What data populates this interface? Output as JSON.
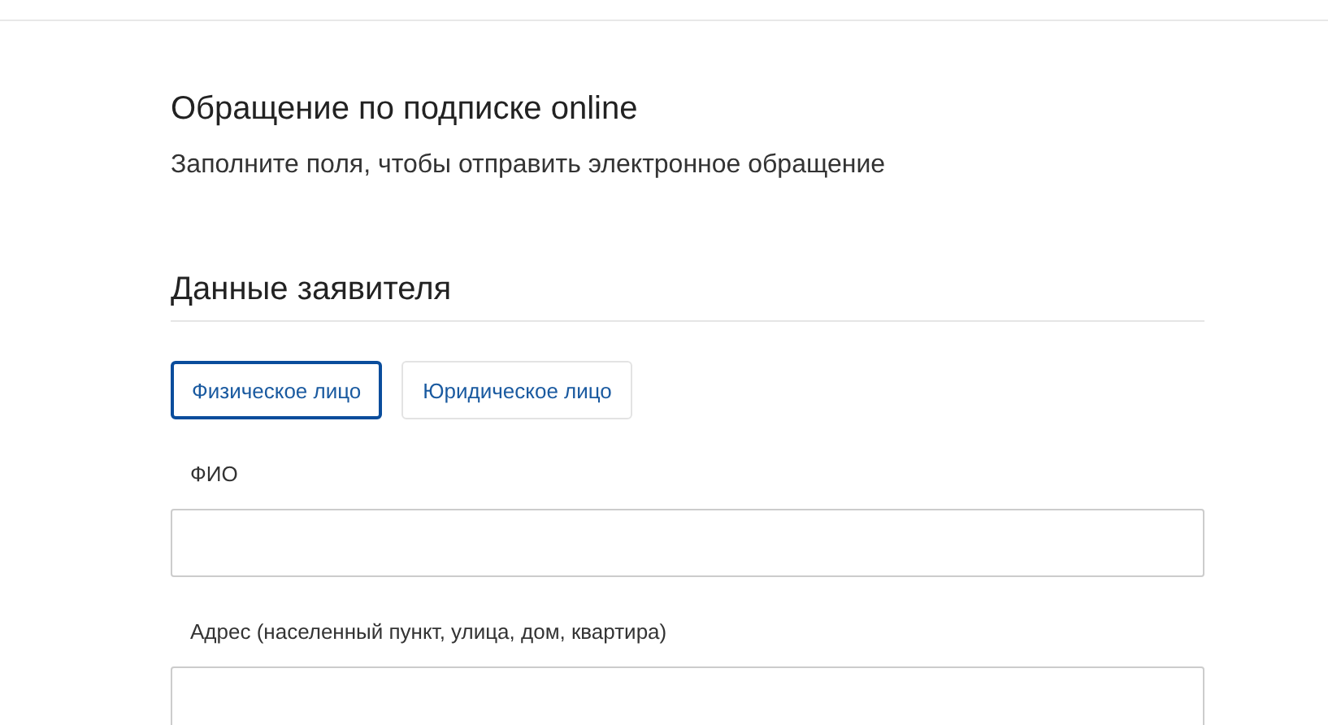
{
  "title": "Обращение по подписке online",
  "subtitle": "Заполните поля, чтобы отправить электронное обращение",
  "section": "Данные заявителя",
  "tabs": [
    {
      "label": "Физическое лицо",
      "selected": true
    },
    {
      "label": "Юридическое лицо",
      "selected": false
    }
  ],
  "fields": [
    {
      "label": "ФИО"
    },
    {
      "label": "Адрес (населенный пункт, улица, дом, квартира)"
    }
  ]
}
